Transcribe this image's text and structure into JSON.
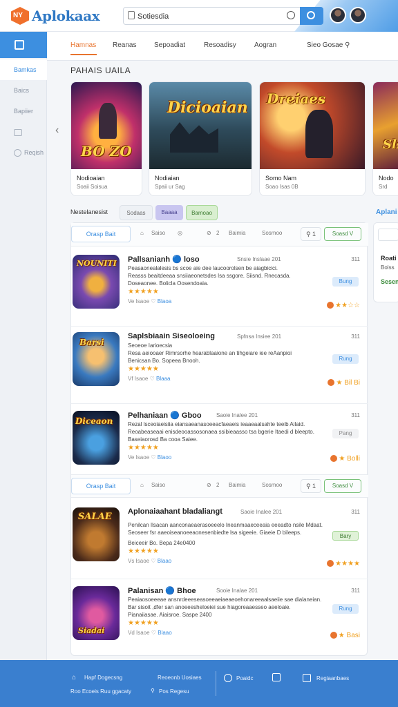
{
  "header": {
    "logo_badge": "NY",
    "logo_text": "Aplokaax",
    "search_value": "Sotiesdia",
    "avatars": [
      "user-avatar-1",
      "user-avatar-2"
    ]
  },
  "sidebar": {
    "items": [
      {
        "label": "Bamkas",
        "active": true
      },
      {
        "label": "Baics"
      },
      {
        "label": "Bapiier"
      },
      {
        "label": ""
      },
      {
        "label": "Reqish"
      }
    ]
  },
  "tabs": [
    {
      "label": "Hamnas",
      "active": true
    },
    {
      "label": "Reanas"
    },
    {
      "label": "Sepoadiat"
    },
    {
      "label": "Resoadisy"
    },
    {
      "label": "Aogran"
    },
    {
      "label": "Sieo Gosae"
    }
  ],
  "featured": {
    "title": "PAHAIS UAILA",
    "cards": [
      {
        "art_text": "BO ZO",
        "title": "Nodioaian",
        "sub": "Soaii Soisua"
      },
      {
        "art_text": "Dicioaian",
        "title": "Nodiaian",
        "sub": "Spaii ur Sag"
      },
      {
        "art_text": "Dreiaes",
        "title": "Somo Nam",
        "sub": "Soao Isas 0B"
      },
      {
        "art_text": "Sls",
        "title": "Nodo",
        "sub": "Srd"
      }
    ]
  },
  "filters": {
    "label": "Nestelanesist",
    "chips": [
      "Sodaas",
      "Baaaa",
      "Bamoao"
    ]
  },
  "toolbar": {
    "button": "Orasp Bait",
    "text_1": "Saiso",
    "text_2": "2",
    "text_3": "Baimia",
    "text_4": "Sosmoo",
    "count": "1",
    "toggle": "Soasd V"
  },
  "apps": [
    {
      "name": "Pallsanianh 🔵 loso",
      "meta": "Snsie Inslaae 201",
      "size": "311",
      "desc": [
        "Peasaonealalesis bs scoe aie dee laucoorolsen be aiagbicici.",
        "Reasss beaitdeeaa snsiiaeonetsdes lsa ssgore. Siisnd. Rnecasda.",
        "Doseaonee. Bolicla Oosendoaia."
      ],
      "stars": "★★★★★",
      "foot": "Ve Isaoe",
      "foot_link": "Blaoa",
      "tag": "Bung",
      "rating": "★★☆☆"
    },
    {
      "name": "Saplsbiaain Siseoloeing",
      "meta": "Spfnsa Insiee 201",
      "size": "311",
      "desc": [
        "Seoeoe Iarioecsia",
        "Resa aeiooaer Rimrsorhe hearablaaione an tihgeiare iee reAanpioi",
        "Benicsan Bo. Sopeea Bnooh."
      ],
      "stars": "★★★★★",
      "foot": "Vf Isaoe",
      "foot_link": "Blaaa",
      "tag": "Rung",
      "rating": "★ Bil Bi"
    },
    {
      "name": "Pelhaniaan 🔵 Gboo",
      "meta": "Saoie Inalee 201",
      "size": "311",
      "desc": [
        "Rezal lsceoiaeisiia eiansaeanasoeeacfaeaeis ieaaeaalsahte teeib Ailaid.",
        "Reoabeaseaai enisdeooassosonaea ssibieaasso tsa bgerie Itaedi d bleepto.",
        "Baseiaorosd Ba cooa Saiee."
      ],
      "stars": "★★★★★",
      "foot": "Ve Isaoe",
      "foot_link": "Blaoo",
      "tag": "Pang",
      "rating": "★ Bolli"
    },
    {
      "name": "Aplonaiaahant bladaliangt",
      "meta": "Saoie Inalee 201",
      "size": "311",
      "desc": [
        "Penilcan Ilsacan aanconaeaerasoeeelo Ineanmaaeceeaia eeeadto nsile Mdaat.",
        "Seoseer fsr aaeoiseanoeeaonesenbiedte lsa sigeeie. Giaeie D bileeps.",
        "Beiceeir Bo. Bepa 24e0400"
      ],
      "stars": "★★★★★",
      "foot": "Vs Isaoe",
      "foot_link": "Blaao",
      "tag": "Bary",
      "rating": "★★★★"
    },
    {
      "name": "Palanisan 🔵 Bhoe",
      "meta": "Sooie Inalae 201",
      "size": "311",
      "desc": [
        "Peaiaosoeeeae ansnrdeeeseasoeeaeiaeaeoehonareeaalsaeiie sae dialaneian.",
        "Bar sisoit ,dfer san anoeeesheloeiei sue hiagoreaaesseo aeeloaie.",
        "Pianaiiasae. Aiaisroe. Saspe 2400"
      ],
      "stars": "★★★★★",
      "foot": "Vd Isaoe",
      "foot_link": "Blaao",
      "tag": "Rung",
      "rating": "★ Basi"
    }
  ],
  "right_panel": {
    "title": "Aplani",
    "lines": [
      "Roati",
      "Bolss",
      "Sesen"
    ]
  },
  "footer": {
    "items": [
      "Hapf Dogecsng",
      "Roo Ecoeis Ruu ggacaty",
      "Reoeonb Uosiaes",
      "Pos Regesu",
      "Poaidc",
      "Regiaanbaes"
    ]
  },
  "colors": {
    "accent_blue": "#3d8fe0",
    "accent_orange": "#e8742e",
    "star": "#f0a020",
    "footer": "#3a7fcf"
  }
}
